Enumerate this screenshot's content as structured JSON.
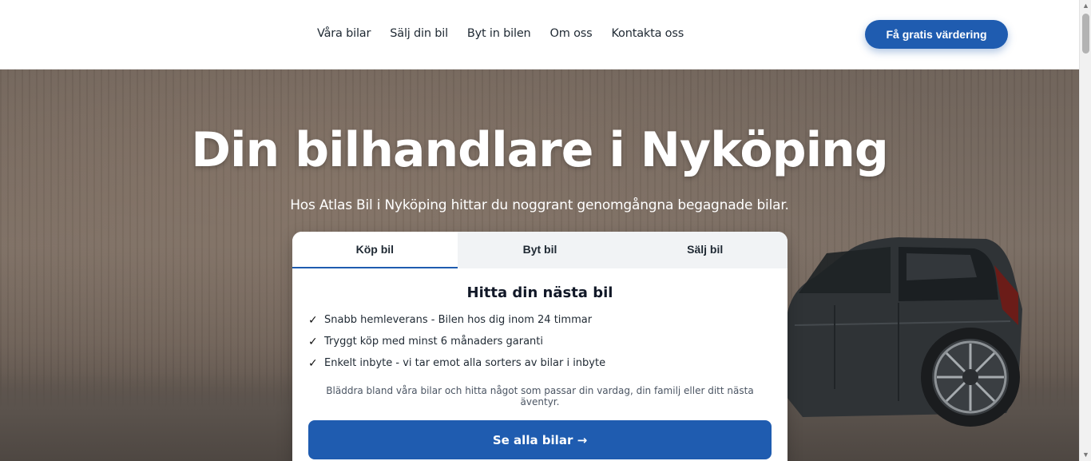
{
  "header": {
    "nav": [
      {
        "label": "Våra bilar"
      },
      {
        "label": "Sälj din bil"
      },
      {
        "label": "Byt in bilen"
      },
      {
        "label": "Om oss"
      },
      {
        "label": "Kontakta oss"
      }
    ],
    "cta_label": "Få gratis värdering",
    "accent_color": "#1f5cb0"
  },
  "hero": {
    "title": "Din bilhandlare i Nyköping",
    "subtitle": "Hos Atlas Bil i Nyköping hittar du noggrant genomgångna begagnade bilar."
  },
  "card": {
    "tabs": [
      {
        "label": "Köp bil",
        "active": true
      },
      {
        "label": "Byt bil",
        "active": false
      },
      {
        "label": "Sälj bil",
        "active": false
      }
    ],
    "title": "Hitta din nästa bil",
    "features": [
      {
        "icon": "check-icon",
        "text": "Snabb hemleverans - Bilen hos dig inom 24 timmar"
      },
      {
        "icon": "check-icon",
        "text": "Tryggt köp med minst 6 månaders garanti"
      },
      {
        "icon": "check-icon",
        "text": "Enkelt inbyte - vi tar emot alla sorters av bilar i inbyte"
      }
    ],
    "note": "Bläddra bland våra bilar och hitta något som passar din vardag, din familj eller ditt nästa äventyr.",
    "button_label": "Se alla bilar →"
  },
  "icons": {
    "check": "✓",
    "scroll_up": "▲",
    "scroll_down": "▼"
  }
}
